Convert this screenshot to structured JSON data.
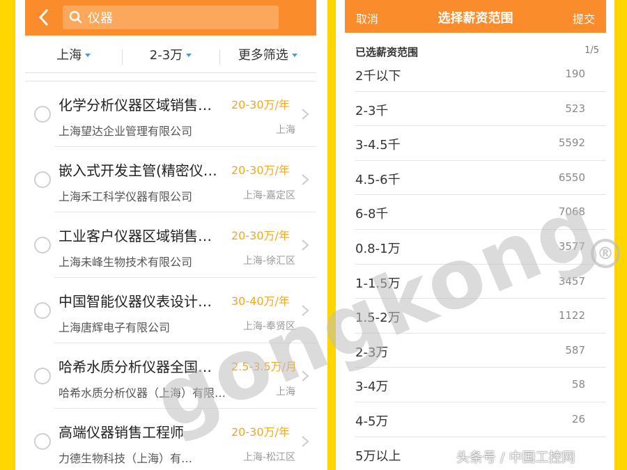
{
  "search": {
    "query": "仪器"
  },
  "filters": [
    {
      "label": "上海"
    },
    {
      "label": "2-3万"
    },
    {
      "label": "更多筛选"
    }
  ],
  "jobs": [
    {
      "title": "化学分析仪器区域销售…",
      "salary": "20-30万/年",
      "company": "上海望达企业管理有限公司",
      "location": "上海"
    },
    {
      "title": "嵌入式开发主管(精密仪…",
      "salary": "20-30万/年",
      "company": "上海禾工科学仪器有限公司",
      "location": "上海-嘉定区"
    },
    {
      "title": "工业客户仪器区域销售…",
      "salary": "20-30万/年",
      "company": "上海未峰生物技术有限公司",
      "location": "上海-徐汇区"
    },
    {
      "title": "中国智能仪器仪表设计…",
      "salary": "30-40万/年",
      "company": "上海唐辉电子有限公司",
      "location": "上海-奉贤区"
    },
    {
      "title": "哈希水质分析仪器全国…",
      "salary": "2.5-3.5万/月",
      "company": "哈希水质分析仪器（上海）有限…",
      "location": "上海"
    },
    {
      "title": "高端仪器销售工程师",
      "salary": "20-30万/年",
      "company": "力德生物科技（上海）有…",
      "location": "上海-松江区"
    }
  ],
  "salary_picker": {
    "cancel": "取消",
    "title": "选择薪资范围",
    "submit": "提交",
    "section_title": "已选薪资范围",
    "page": "1/5",
    "options": [
      {
        "label": "2千以下",
        "count": "190"
      },
      {
        "label": "2-3千",
        "count": "523"
      },
      {
        "label": "3-4.5千",
        "count": "5592"
      },
      {
        "label": "4.5-6千",
        "count": "6550"
      },
      {
        "label": "6-8千",
        "count": "7068"
      },
      {
        "label": "0.8-1万",
        "count": "3577"
      },
      {
        "label": "1-1.5万",
        "count": "3457"
      },
      {
        "label": "1.5-2万",
        "count": "1122"
      },
      {
        "label": "2-3万",
        "count": "587"
      },
      {
        "label": "3-4万",
        "count": "58"
      },
      {
        "label": "4-5万",
        "count": "26"
      },
      {
        "label": "5万以上",
        "count": ""
      }
    ]
  },
  "watermark": {
    "text": "gongkong",
    "mark": "®",
    "source": "头条号 / 中国工控网"
  },
  "colors": {
    "accent": "#FB8C2C",
    "salary": "#F5A623",
    "caret": "#3A9FE0",
    "frame": "#FFD600"
  }
}
